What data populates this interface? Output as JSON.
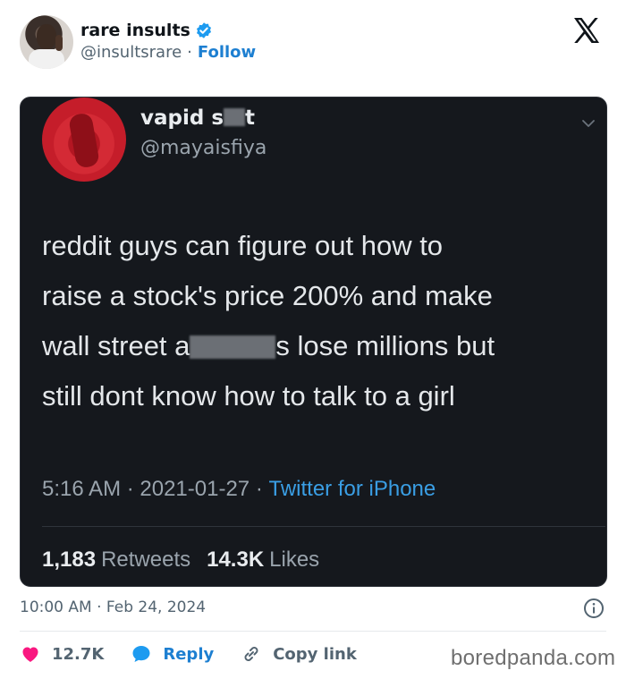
{
  "author": {
    "display_name": "rare insults",
    "handle": "@insultsrare",
    "separator": "·",
    "follow_label": "Follow"
  },
  "embedded_tweet": {
    "display_name_prefix": "vapid s",
    "display_name_suffix": "t",
    "handle": "@mayaisfiya",
    "text_line1": "reddit guys can figure out how to",
    "text_line2": "raise a stock's price 200% and make",
    "text_line3_prefix": "wall street a",
    "text_line3_suffix": "s lose millions but",
    "text_line4": "still dont know how to talk to a girl",
    "time": "5:16 AM",
    "date": "2021-01-27",
    "sep": " · ",
    "source": "Twitter for iPhone",
    "retweets_count": "1,183",
    "retweets_label": "Retweets",
    "likes_count": "14.3K",
    "likes_label": "Likes"
  },
  "timestamp": "10:00 AM · Feb 24, 2024",
  "actions": {
    "likes": "12.7K",
    "reply": "Reply",
    "copy_link": "Copy link"
  },
  "watermark": "boredpanda.com",
  "icons": [
    "verified-badge-icon",
    "x-logo-icon",
    "chevron-down-icon",
    "info-icon",
    "heart-icon",
    "reply-bubble-icon",
    "link-icon"
  ],
  "colors": {
    "accent": "#1d9bf0",
    "like": "#f91880",
    "card_bg": "#15181d"
  }
}
